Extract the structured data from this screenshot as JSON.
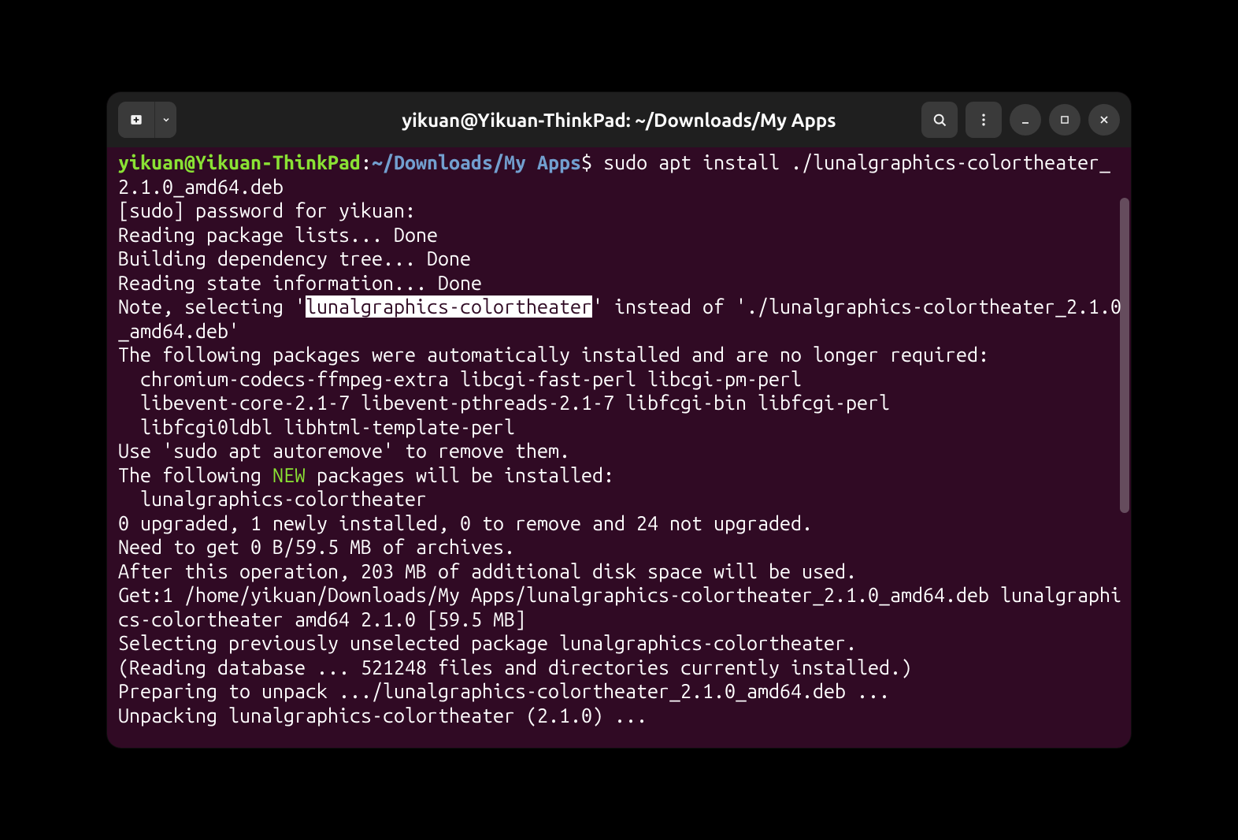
{
  "titlebar": {
    "title": "yikuan@Yikuan-ThinkPad: ~/Downloads/My Apps"
  },
  "prompt": {
    "user_host": "yikuan@Yikuan-ThinkPad",
    "sep": ":",
    "path": "~/Downloads/My Apps",
    "dollar": "$ ",
    "command": "sudo apt install ./lunalgraphics-colortheater_2.1.0_amd64.deb"
  },
  "lines": {
    "l1": "[sudo] password for yikuan: ",
    "l2": "Reading package lists... Done",
    "l3": "Building dependency tree... Done",
    "l4": "Reading state information... Done",
    "l5a": "Note, selecting '",
    "l5h": "lunalgraphics-colortheater",
    "l5b": "' instead of './lunalgraphics-colortheater_2.1.0_amd64.deb'",
    "l6": "The following packages were automatically installed and are no longer required:",
    "l7": "  chromium-codecs-ffmpeg-extra libcgi-fast-perl libcgi-pm-perl",
    "l8": "  libevent-core-2.1-7 libevent-pthreads-2.1-7 libfcgi-bin libfcgi-perl",
    "l9": "  libfcgi0ldbl libhtml-template-perl",
    "l10": "Use 'sudo apt autoremove' to remove them.",
    "l11a": "The following ",
    "l11b": "NEW",
    "l11c": " packages will be installed:",
    "l12": "  lunalgraphics-colortheater",
    "l13": "0 upgraded, 1 newly installed, 0 to remove and 24 not upgraded.",
    "l14": "Need to get 0 B/59.5 MB of archives.",
    "l15": "After this operation, 203 MB of additional disk space will be used.",
    "l16": "Get:1 /home/yikuan/Downloads/My Apps/lunalgraphics-colortheater_2.1.0_amd64.deb lunalgraphics-colortheater amd64 2.1.0 [59.5 MB]",
    "l17": "Selecting previously unselected package lunalgraphics-colortheater.",
    "l18": "(Reading database ... 521248 files and directories currently installed.)",
    "l19": "Preparing to unpack .../lunalgraphics-colortheater_2.1.0_amd64.deb ...",
    "l20": "Unpacking lunalgraphics-colortheater (2.1.0) ..."
  },
  "colors": {
    "bg": "#300a24",
    "prompt_user": "#8ae234",
    "prompt_path": "#729fcf",
    "text": "#ffffff"
  }
}
